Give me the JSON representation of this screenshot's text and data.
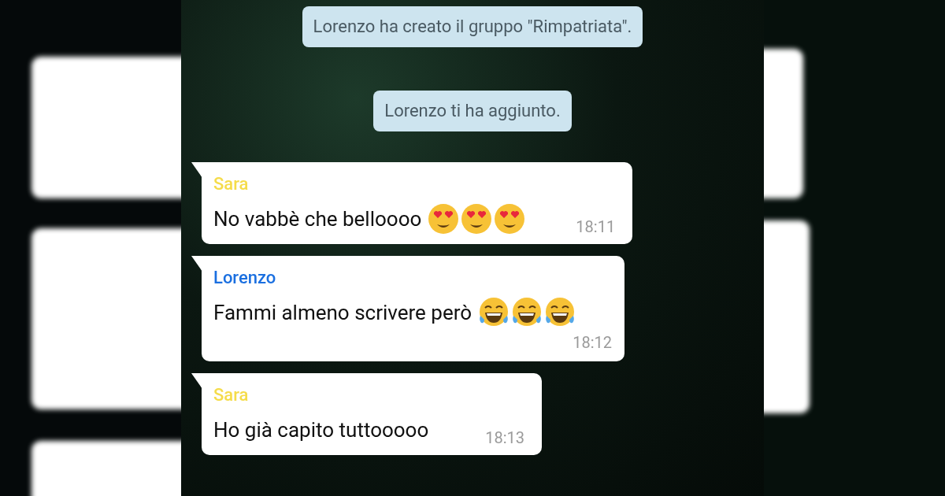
{
  "system_messages": [
    "Lorenzo ha creato il gruppo \"Rimpatriata\".",
    "Lorenzo ti ha aggiunto."
  ],
  "messages": [
    {
      "sender": "Sara",
      "color": "#f5dc4a",
      "text": "No vabbè che belloooo",
      "emojis": [
        {
          "kind": "heart-eyes"
        },
        {
          "kind": "heart-eyes"
        },
        {
          "kind": "heart-eyes"
        }
      ],
      "time": "18:11",
      "kind": "inline"
    },
    {
      "sender": "Lorenzo",
      "color": "#1a6fe0",
      "text": "Fammi almeno scrivere però",
      "emojis": [
        {
          "kind": "tears-of-joy"
        },
        {
          "kind": "tears-of-joy"
        },
        {
          "kind": "tears-of-joy"
        }
      ],
      "time": "18:12",
      "kind": "below"
    },
    {
      "sender": "Sara",
      "color": "#f5dc4a",
      "text": "Ho già capito tuttooooo",
      "time": "18:13",
      "kind": "inline"
    }
  ]
}
